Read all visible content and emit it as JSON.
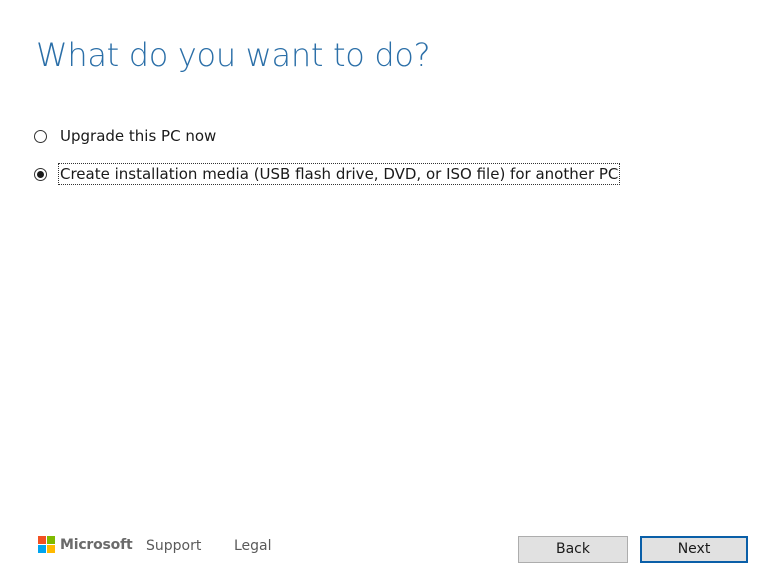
{
  "heading": "What do you want to do?",
  "options": [
    {
      "label": "Upgrade this PC now",
      "selected": false
    },
    {
      "label": "Create installation media (USB flash drive, DVD, or ISO file) for another PC",
      "selected": true
    }
  ],
  "footer": {
    "brand": "Microsoft",
    "links": [
      "Support",
      "Legal"
    ],
    "back_label": "Back",
    "next_label": "Next"
  },
  "colors": {
    "heading": "#2b6fa8",
    "logo_red": "#f25022",
    "logo_green": "#7fba00",
    "logo_blue": "#00a4ef",
    "logo_yellow": "#ffb900",
    "next_border": "#0a5fa8"
  },
  "icons": {
    "logo": "microsoft-logo-icon",
    "radio_unchecked": "radio-unchecked-icon",
    "radio_checked": "radio-checked-icon"
  }
}
